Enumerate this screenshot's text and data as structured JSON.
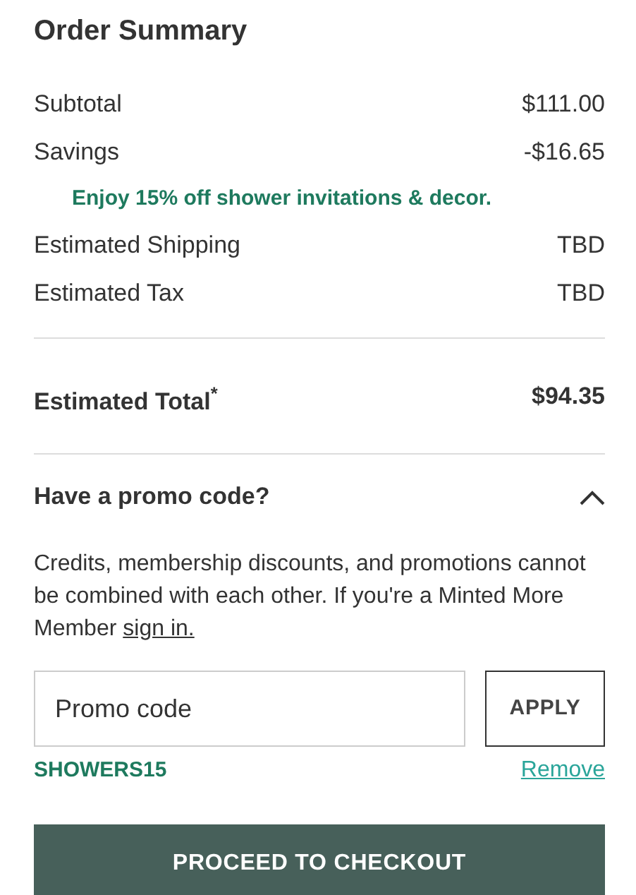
{
  "title": "Order Summary",
  "lines": [
    {
      "kind": "row",
      "label": "Subtotal",
      "value": "$111.00"
    },
    {
      "kind": "row",
      "label": "Savings",
      "value": "-$16.65"
    },
    {
      "kind": "note",
      "label": "Enjoy 15% off shower invitations & decor."
    },
    {
      "kind": "row",
      "label": "Estimated Shipping",
      "value": "TBD"
    },
    {
      "kind": "row",
      "label": "Estimated Tax",
      "value": "TBD"
    }
  ],
  "total": {
    "label": "Estimated Total$^{*}$",
    "value": "$94.35"
  },
  "promo": {
    "heading": "Have a promo code?",
    "expanded": true,
    "text": "Credits, membership discounts, and promotions cannot be combined with each other. If you're a Minted More Member",
    "link": "sign in.",
    "field": {
      "placeholder": "Promo code"
    },
    "apply": "APPLY",
    "applied_code": "SHOWERS15",
    "remove": "Remove"
  },
  "checkout": "PROCEED TO CHECKOUT"
}
